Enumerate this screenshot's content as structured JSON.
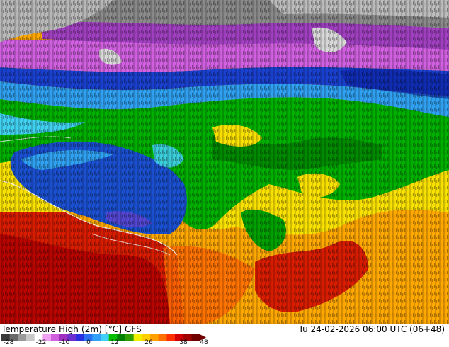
{
  "map": {
    "title": "Temperature High (2m) [°C] GFS",
    "datetime": "Tu 24-02-2026 06:00 UTC (06+48)",
    "legend": {
      "ticks": [
        "-28",
        "-22",
        "-10",
        "0",
        "12",
        "26",
        "38",
        "48"
      ],
      "colors": [
        "#3a3a3a",
        "#6a6a6a",
        "#9a9a9a",
        "#c8c8c8",
        "#ffffff",
        "#f0a0f0",
        "#d060e0",
        "#a030c0",
        "#6a30d0",
        "#2a30e0",
        "#2a70f0",
        "#30a0f8",
        "#40d0f8",
        "#00c000",
        "#008000",
        "#30a000",
        "#f0f000",
        "#ffd000",
        "#ffa000",
        "#ff7000",
        "#ff3000",
        "#d00000",
        "#a00000",
        "#700000"
      ]
    },
    "colors": {
      "cold_gray": "#8a8a8a",
      "purple": "#a050c0",
      "magenta": "#d060e0",
      "blue": "#1a50d0",
      "light_blue": "#30a0f0",
      "cyan": "#40d0f0",
      "green": "#00b000",
      "dark_green": "#007a00",
      "yellow": "#f8e000",
      "orange": "#ffa800",
      "red": "#e02000",
      "dark_red": "#a00000"
    }
  }
}
